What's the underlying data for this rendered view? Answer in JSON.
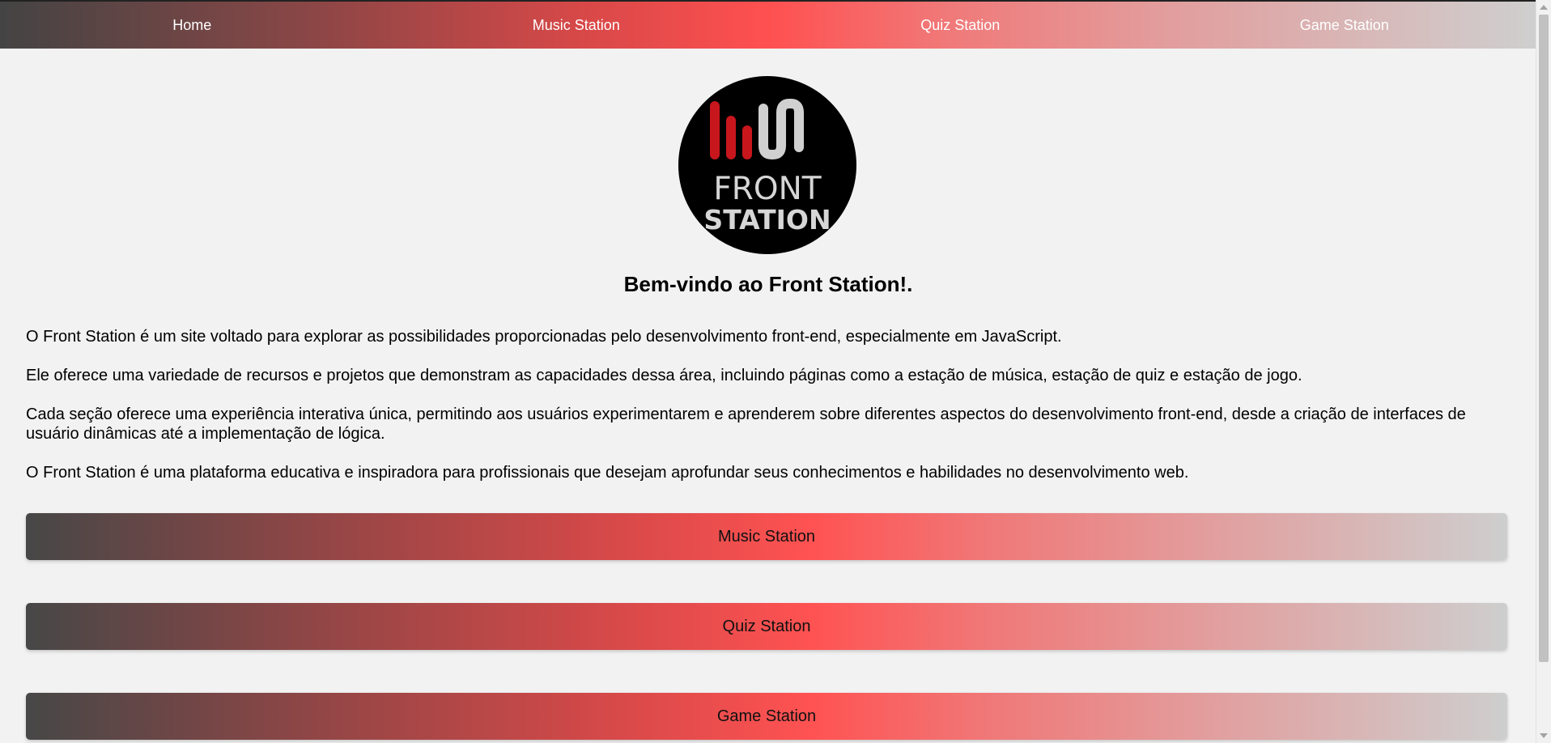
{
  "nav": {
    "items": [
      {
        "label": "Home"
      },
      {
        "label": "Music Station"
      },
      {
        "label": "Quiz Station"
      },
      {
        "label": "Game Station"
      }
    ]
  },
  "logo": {
    "line1": "FRONT",
    "line2": "STATION"
  },
  "main": {
    "title": "Bem-vindo ao Front Station!.",
    "paragraphs": [
      "O Front Station é um site voltado para explorar as possibilidades proporcionadas pelo desenvolvimento front-end, especialmente em JavaScript.",
      "Ele oferece uma variedade de recursos e projetos que demonstram as capacidades dessa área, incluindo páginas como a estação de música, estação de quiz e estação de jogo.",
      "Cada seção oferece uma experiência interativa única, permitindo aos usuários experimentarem e aprenderem sobre diferentes aspectos do desenvolvimento front-end, desde a criação de interfaces de usuário dinâmicas até a implementação de lógica.",
      "O Front Station é uma plataforma educativa e inspiradora para profissionais que desejam aprofundar seus conhecimentos e habilidades no desenvolvimento web."
    ]
  },
  "stations": {
    "music": "Music Station",
    "quiz": "Quiz Station",
    "game": "Game Station"
  },
  "colors": {
    "accent_red": "#ff5050",
    "dark": "#444444",
    "light": "#cfcfcf",
    "logo_red": "#c8161d",
    "logo_gray": "#d0d0d0"
  }
}
